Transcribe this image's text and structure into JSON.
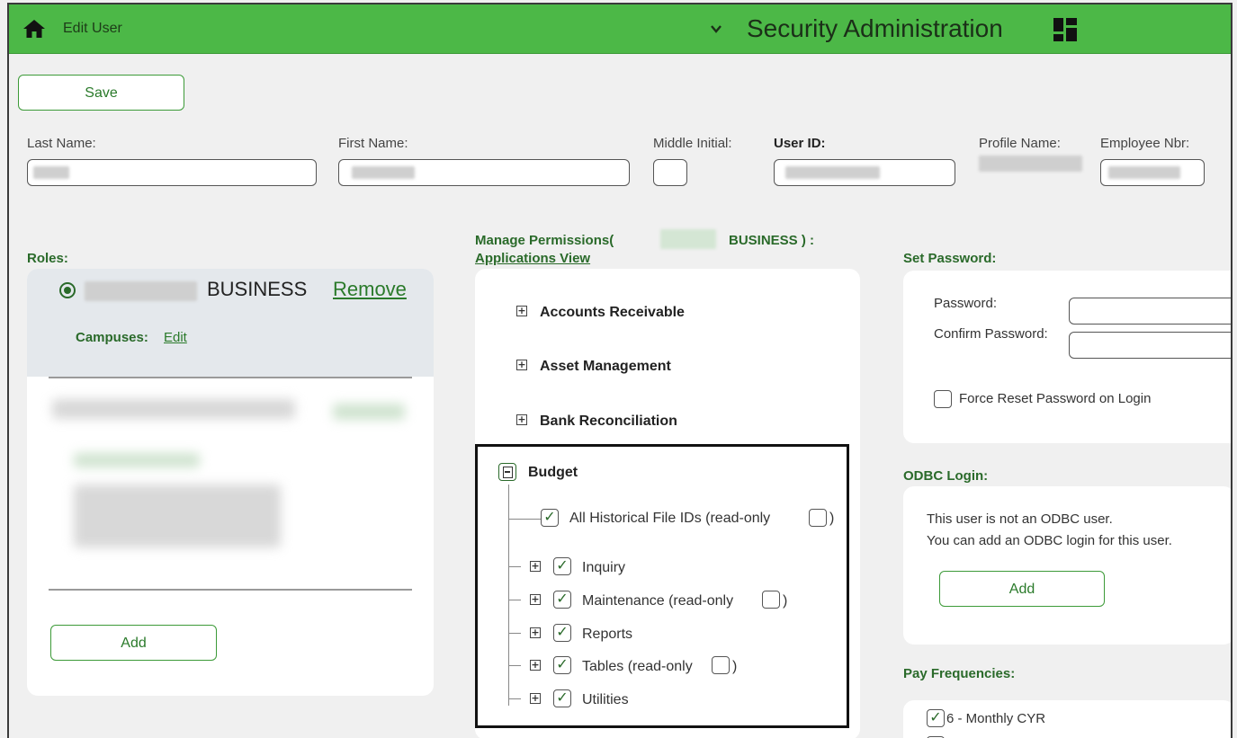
{
  "header": {
    "page_name": "Edit User",
    "app_title": "Security Administration",
    "bar_color": "#4cb847",
    "icons": [
      "home-icon",
      "chevron-down-icon",
      "app-grid-icon"
    ]
  },
  "toolbar": {
    "save_label": "Save"
  },
  "user_fields": {
    "last_name_label": "Last Name:",
    "first_name_label": "First Name:",
    "middle_initial_label": "Middle Initial:",
    "user_id_label": "User ID:",
    "profile_name_label": "Profile Name:",
    "employee_nbr_label": "Employee Nbr:",
    "middle_initial_value": ""
  },
  "roles": {
    "title": "Roles:",
    "items": [
      {
        "name": "BUSINESS",
        "remove_label": "Remove",
        "campuses_label": "Campuses:",
        "edit_label": "Edit",
        "selected": true
      }
    ],
    "add_label": "Add"
  },
  "permissions": {
    "title_prefix": "Manage Permissions(",
    "title_role": "BUSINESS ) :",
    "view_link": "Applications View",
    "applications": [
      "Accounts Receivable",
      "Asset Management",
      "Bank Reconciliation"
    ],
    "budget": {
      "label": "Budget",
      "historical_label": "All Historical File IDs (read-only",
      "children": [
        {
          "label": "Inquiry",
          "checked": true
        },
        {
          "label": "Maintenance (read-only",
          "checked": true
        },
        {
          "label": "Reports",
          "checked": true
        },
        {
          "label": "Tables (read-only",
          "checked": true
        },
        {
          "label": "Utilities",
          "checked": true
        }
      ]
    }
  },
  "password": {
    "title": "Set Password:",
    "password_label": "Password:",
    "confirm_label": "Confirm Password:",
    "force_reset_label": "Force Reset Password on Login"
  },
  "odbc": {
    "title": "ODBC Login:",
    "line1": "This user is not an ODBC user.",
    "line2": "You can add an ODBC login for this user.",
    "add_label": "Add"
  },
  "pay_frequencies": {
    "title": "Pay Frequencies:",
    "items": [
      {
        "label": "6 - Monthly CYR",
        "checked": true
      }
    ]
  }
}
